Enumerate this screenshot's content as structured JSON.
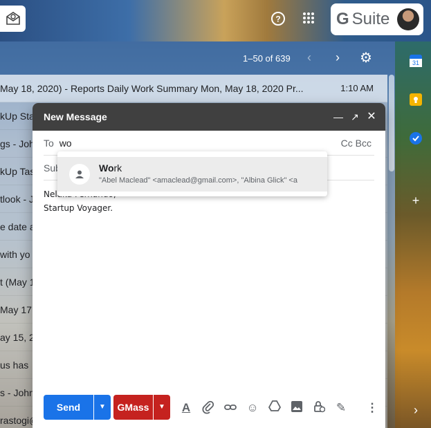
{
  "toolbar": {
    "count": "1–50 of 639"
  },
  "gsuite": {
    "label": "Suite",
    "g": "G"
  },
  "email_rows": [
    {
      "text": "May 18, 2020) - Reports Daily Work Summary Mon, May 18, 2020 Pr...",
      "time": "1:10 AM"
    },
    {
      "text": "kUp Sta",
      "time": ""
    },
    {
      "text": "gs - John",
      "time": ""
    },
    {
      "text": "kUp Tas",
      "time": ""
    },
    {
      "text": "tlook - J",
      "time": ""
    },
    {
      "text": "e date a",
      "time": ""
    },
    {
      "text": "with yo",
      "time": ""
    },
    {
      "text": "t (May 1",
      "time": ""
    },
    {
      "text": "May 17,",
      "time": ""
    },
    {
      "text": "ay 15, 2",
      "time": ""
    },
    {
      "text": "us has",
      "time": ""
    },
    {
      "text": "s - John",
      "time": ""
    },
    {
      "text": "rastogi@",
      "time": ""
    }
  ],
  "compose": {
    "title": "New Message",
    "to_label": "To",
    "to_value": "wo",
    "cc_bcc": "Cc Bcc",
    "subject_label": "Sub",
    "body_line1": "Nelaka Fernando,",
    "body_line2": "Startup Voyager.",
    "send_label": "Send",
    "gmass_label": "GMass"
  },
  "autocomplete": {
    "name_bold": "Wo",
    "name_rest": "rk",
    "detail": "\"Abel Maclead\" <amaclead@gmail.com>, \"Albina Glick\" <a"
  },
  "colors": {
    "send": "#1a73e8",
    "gmass": "#c5221f",
    "compose_header": "#404040"
  }
}
